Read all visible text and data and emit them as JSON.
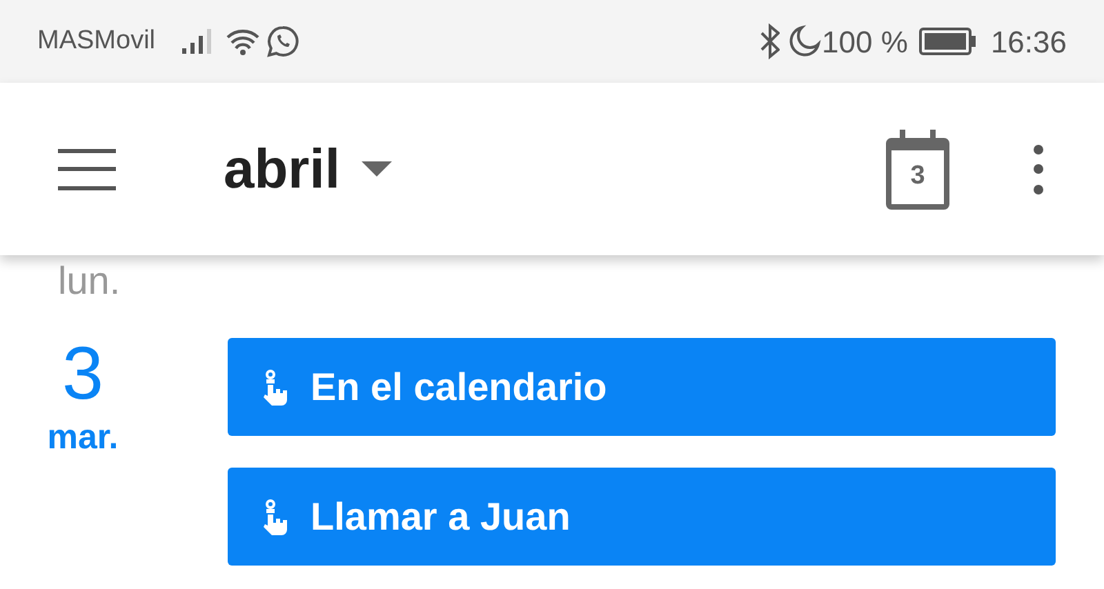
{
  "status_bar": {
    "carrier": "MASMovil",
    "battery_text": "100 %",
    "time": "16:36"
  },
  "app_bar": {
    "title": "abril",
    "today_icon_day": "3"
  },
  "previous_day": {
    "weekday": "lun."
  },
  "day": {
    "number": "3",
    "weekday": "mar.",
    "today": true,
    "events": [
      {
        "kind": "reminder",
        "title": "En el calendario",
        "color": "#0a84f5"
      },
      {
        "kind": "reminder",
        "title": "Llamar a Juan",
        "color": "#0a84f5"
      }
    ]
  }
}
